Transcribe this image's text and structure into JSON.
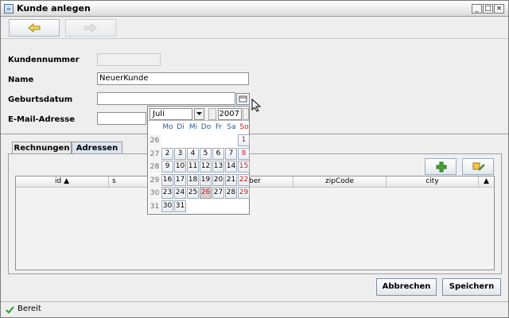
{
  "window": {
    "title": "Kunde anlegen",
    "controls": [
      "_",
      "□",
      "×"
    ]
  },
  "toolbar": {
    "back_icon": "arrow-left-icon",
    "forward_icon": "arrow-right-icon"
  },
  "form": {
    "customer_number_label": "Kundennummer",
    "customer_number_value": "",
    "name_label": "Name",
    "name_value": "NeuerKunde",
    "birthdate_label": "Geburtsdatum",
    "birthdate_value": "",
    "email_label": "E-Mail-Adresse",
    "email_value": ""
  },
  "tabs": [
    {
      "label": "Rechnungen"
    },
    {
      "label": "Adressen"
    }
  ],
  "table": {
    "columns": [
      "id ▲",
      "s",
      "ber",
      "zipCode",
      "city"
    ],
    "sort_indicator": "▲"
  },
  "actions": {
    "add_icon": "plus-icon",
    "edit_icon": "edit-address-icon",
    "cancel_label": "Abbrechen",
    "save_label": "Speichern"
  },
  "status": {
    "text": "Bereit",
    "icon": "check-icon"
  },
  "calendar": {
    "month": "Juli",
    "year": "2007",
    "weekdays": [
      "Mo",
      "Di",
      "Mi",
      "Do",
      "Fr",
      "Sa",
      "So"
    ],
    "weeks": [
      {
        "week": "26",
        "days": [
          "",
          "",
          "",
          "",
          "",
          "",
          "1"
        ]
      },
      {
        "week": "27",
        "days": [
          "2",
          "3",
          "4",
          "5",
          "6",
          "7",
          "8"
        ]
      },
      {
        "week": "28",
        "days": [
          "9",
          "10",
          "11",
          "12",
          "13",
          "14",
          "15"
        ]
      },
      {
        "week": "29",
        "days": [
          "16",
          "17",
          "18",
          "19",
          "20",
          "21",
          "22"
        ]
      },
      {
        "week": "30",
        "days": [
          "23",
          "24",
          "25",
          "26",
          "27",
          "28",
          "29"
        ]
      },
      {
        "week": "31",
        "days": [
          "30",
          "31",
          "",
          "",
          "",
          "",
          ""
        ]
      }
    ],
    "selected_day": "26",
    "colors": {
      "weekday": "#2d5c8d",
      "sunday": "#bb2222"
    }
  }
}
